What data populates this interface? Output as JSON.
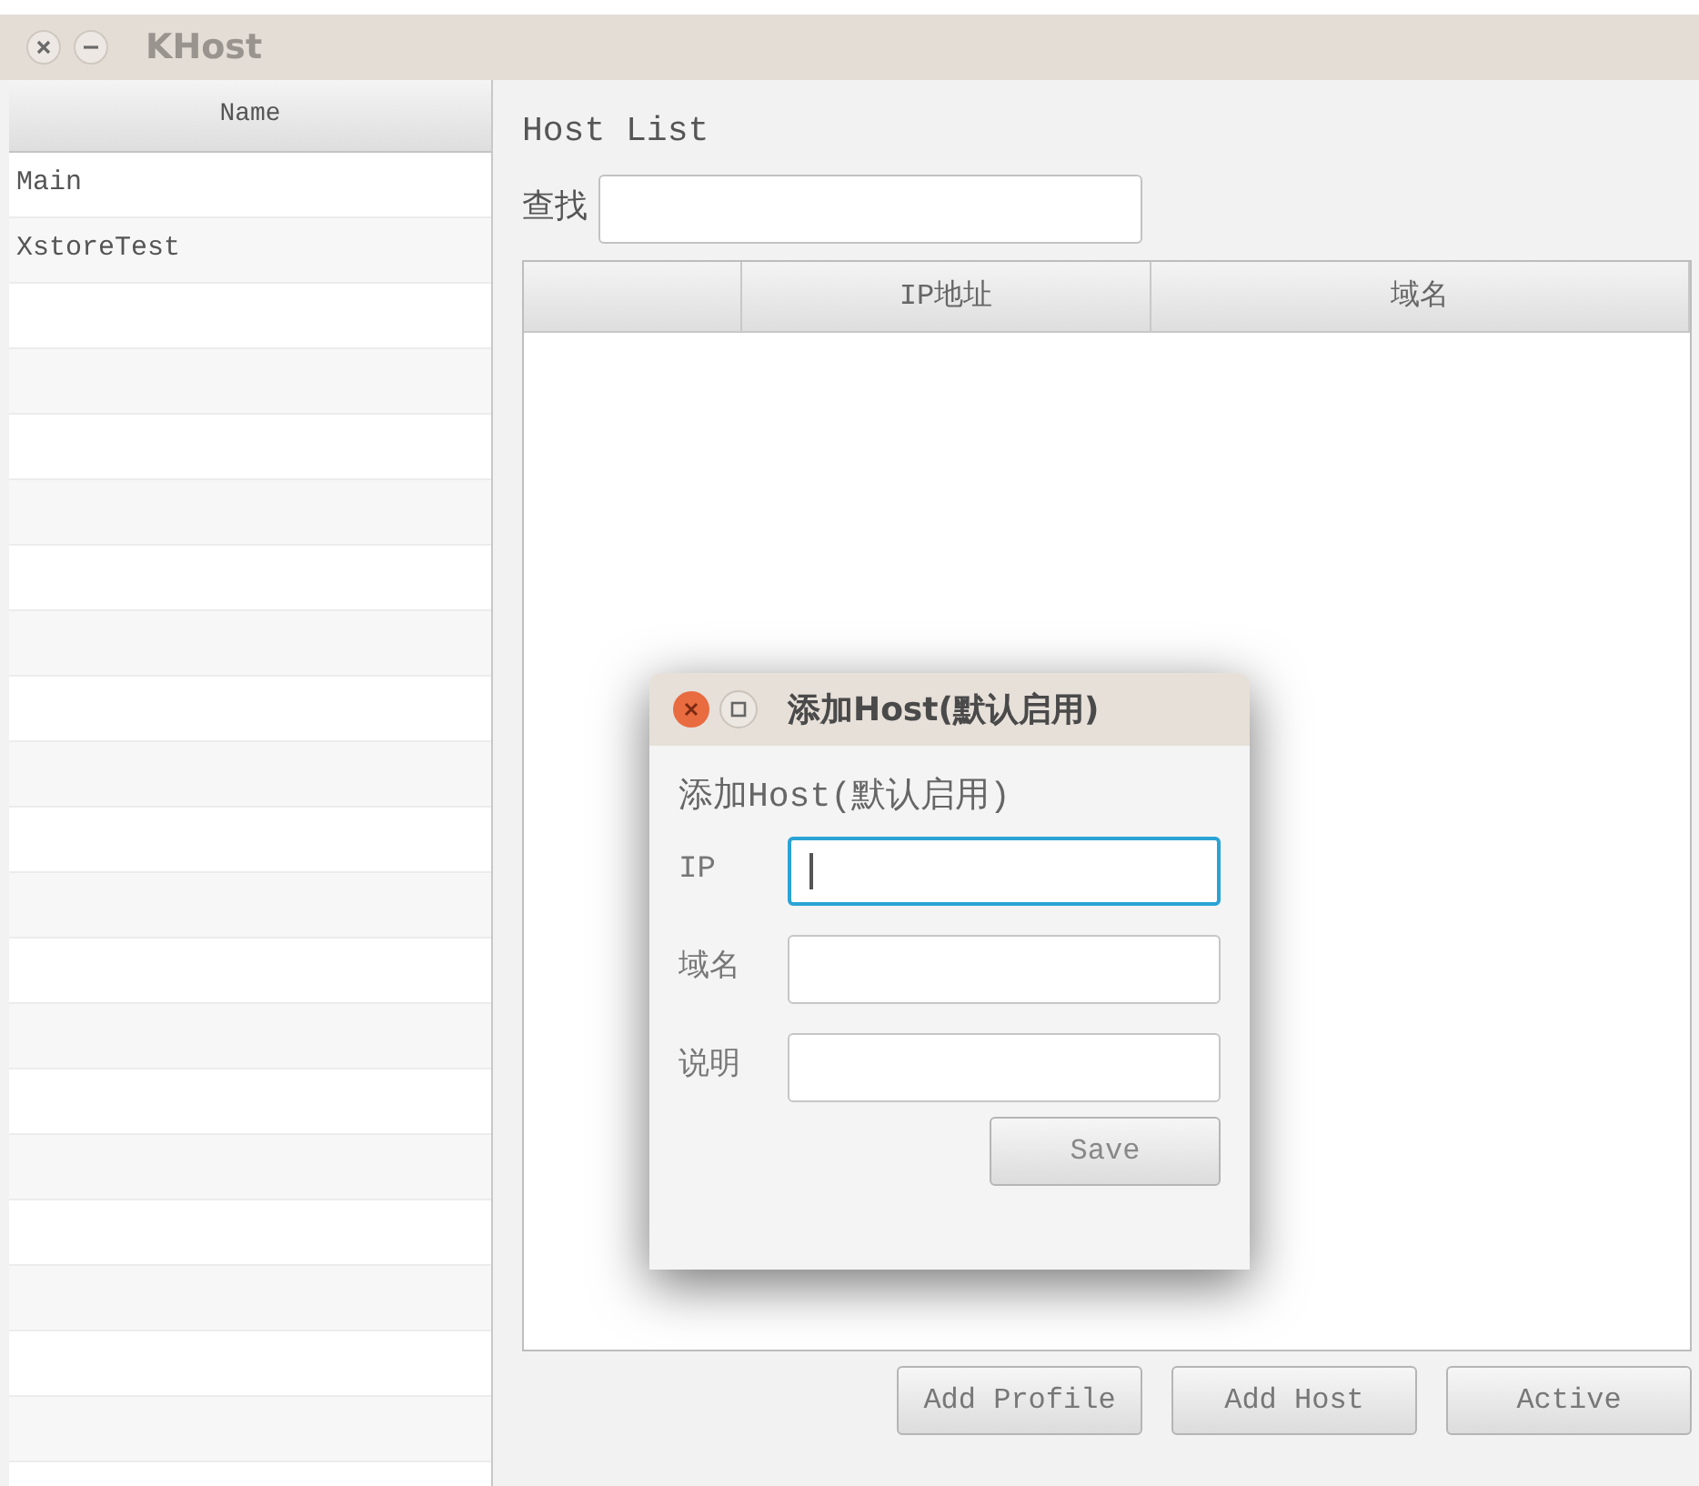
{
  "window": {
    "title": "KHost"
  },
  "sidebar": {
    "column": "Name",
    "rows": [
      "Main",
      "XstoreTest"
    ]
  },
  "main": {
    "title": "Host List",
    "search_label": "查找",
    "table": {
      "columns": [
        "IP地址",
        "域名"
      ]
    },
    "buttons": [
      "Add Profile",
      "Add Host",
      "Active"
    ]
  },
  "dialog": {
    "title": "添加Host(默认启用)",
    "heading": "添加Host(默认启用)",
    "fields": [
      {
        "label": "IP",
        "focused": true
      },
      {
        "label": "域名",
        "focused": false
      },
      {
        "label": "说明",
        "focused": false
      }
    ],
    "button": "Save"
  }
}
